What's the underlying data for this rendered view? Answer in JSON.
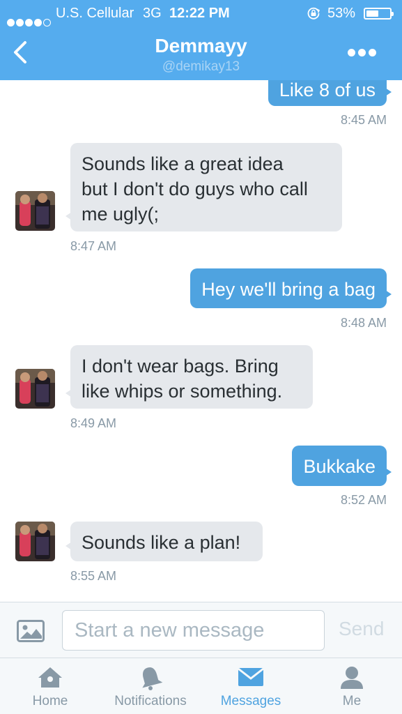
{
  "status_bar": {
    "carrier": "U.S. Cellular",
    "network": "3G",
    "time": "12:22 PM",
    "battery_percent": "53%",
    "battery_level": 0.53,
    "signal_bars": 4,
    "signal_max": 5
  },
  "header": {
    "name": "Demmayy",
    "handle": "@demikay13",
    "back_icon": "chevron-left-icon",
    "more_icon": "more-dots-icon"
  },
  "conversation": {
    "messages": [
      {
        "direction": "out",
        "text": "Like 8 of us",
        "time": "8:45 AM"
      },
      {
        "direction": "in",
        "text": "Sounds like a great idea\nbut I don't do guys who call\nme ugly(;",
        "time": "8:47 AM"
      },
      {
        "direction": "out",
        "text": "Hey we'll bring a bag",
        "time": "8:48 AM"
      },
      {
        "direction": "in",
        "text": "I don't wear bags. Bring\nlike whips or something.",
        "time": "8:49 AM"
      },
      {
        "direction": "out",
        "text": "Bukkake",
        "time": "8:52 AM"
      },
      {
        "direction": "in",
        "text": "Sounds like a plan!",
        "time": "8:55 AM"
      }
    ]
  },
  "composer": {
    "placeholder": "Start a new message",
    "send_label": "Send",
    "photo_icon": "photo-icon"
  },
  "tabbar": {
    "tabs": [
      {
        "label": "Home",
        "icon": "home-icon",
        "active": false
      },
      {
        "label": "Notifications",
        "icon": "bell-icon",
        "active": false
      },
      {
        "label": "Messages",
        "icon": "envelope-icon",
        "active": true
      },
      {
        "label": "Me",
        "icon": "person-icon",
        "active": false
      }
    ]
  },
  "colors": {
    "brand_blue": "#55acee",
    "outgoing_bubble": "#4fa3e0",
    "incoming_bubble": "#e5e8ec",
    "muted_text": "#8899a6"
  }
}
